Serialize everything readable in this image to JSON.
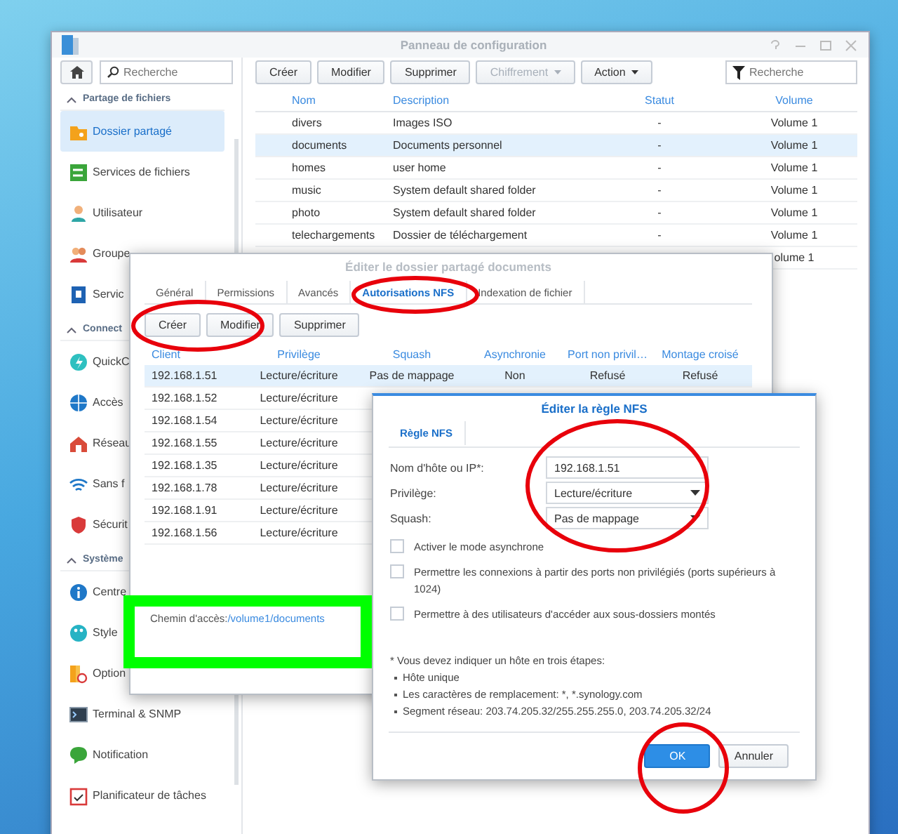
{
  "window": {
    "title": "Panneau de configuration"
  },
  "sidebar": {
    "search": {
      "placeholder": "Recherche"
    },
    "sections": [
      {
        "title": "Partage de fichiers",
        "expanded": true,
        "items": [
          {
            "label": "Dossier partagé",
            "selected": true
          },
          {
            "label": "Services de fichiers",
            "selected": false
          },
          {
            "label": "Utilisateur",
            "selected": false
          },
          {
            "label": "Groupe",
            "selected": false
          },
          {
            "label": "Servic",
            "selected": false
          }
        ]
      },
      {
        "title": "Connect",
        "expanded": true,
        "items": [
          {
            "label": "QuickC",
            "selected": false
          },
          {
            "label": "Accès",
            "selected": false
          },
          {
            "label": "Réseau",
            "selected": false
          },
          {
            "label": "Sans f",
            "selected": false
          },
          {
            "label": "Sécurit",
            "selected": false
          }
        ]
      },
      {
        "title": "Système",
        "expanded": true,
        "items": [
          {
            "label": "Centre",
            "selected": false
          },
          {
            "label": "Style",
            "selected": false
          },
          {
            "label": "Option",
            "selected": false
          },
          {
            "label": "Terminal & SNMP",
            "selected": false
          },
          {
            "label": "Notification",
            "selected": false
          },
          {
            "label": "Planificateur de tâches",
            "selected": false
          }
        ]
      }
    ]
  },
  "toolbar": {
    "buttons": [
      {
        "label": "Créer",
        "disabled": false,
        "dropdown": false
      },
      {
        "label": "Modifier",
        "disabled": false,
        "dropdown": false
      },
      {
        "label": "Supprimer",
        "disabled": false,
        "dropdown": false
      },
      {
        "label": "Chiffrement",
        "disabled": true,
        "dropdown": true
      },
      {
        "label": "Action",
        "disabled": false,
        "dropdown": true
      }
    ],
    "filter": {
      "placeholder": "Recherche"
    }
  },
  "table": {
    "columns": [
      "Nom",
      "Description",
      "Statut",
      "Volume"
    ],
    "rows": [
      {
        "name": "divers",
        "description": "Images ISO",
        "status": "-",
        "volume": "Volume 1",
        "selected": false
      },
      {
        "name": "documents",
        "description": "Documents personnel",
        "status": "-",
        "volume": "Volume 1",
        "selected": true
      },
      {
        "name": "homes",
        "description": "user home",
        "status": "-",
        "volume": "Volume 1",
        "selected": false
      },
      {
        "name": "music",
        "description": "System default shared folder",
        "status": "-",
        "volume": "Volume 1",
        "selected": false
      },
      {
        "name": "photo",
        "description": "System default shared folder",
        "status": "-",
        "volume": "Volume 1",
        "selected": false
      },
      {
        "name": "telechargements",
        "description": "Dossier de téléchargement",
        "status": "-",
        "volume": "Volume 1",
        "selected": false
      },
      {
        "volume": "olume 1",
        "selected": false
      }
    ]
  },
  "share_dialog": {
    "title": "Éditer le dossier partagé documents",
    "tabs": [
      {
        "label": "Général",
        "selected": false
      },
      {
        "label": "Permissions",
        "selected": false
      },
      {
        "label": "Avancés",
        "selected": false
      },
      {
        "label": "Autorisations NFS",
        "selected": true
      },
      {
        "label": "Indexation de fichier",
        "selected": false
      }
    ],
    "buttons": [
      "Créer",
      "Modifier",
      "Supprimer"
    ],
    "table": {
      "columns": [
        "Client",
        "Privilège",
        "Squash",
        "Asynchronie",
        "Port non privil…",
        "Montage croisé"
      ],
      "rows": [
        {
          "client": "192.168.1.51",
          "privilege": "Lecture/écriture",
          "squash": "Pas de mappage",
          "async": "Non",
          "port": "Refusé",
          "cross_mount": "Refusé",
          "selected": true
        },
        {
          "client": "192.168.1.52",
          "privilege": "Lecture/écriture",
          "selected": false
        },
        {
          "client": "192.168.1.54",
          "privilege": "Lecture/écriture",
          "selected": false
        },
        {
          "client": "192.168.1.55",
          "privilege": "Lecture/écriture",
          "selected": false
        },
        {
          "client": "192.168.1.35",
          "privilege": "Lecture/écriture",
          "selected": false
        },
        {
          "client": "192.168.1.78",
          "privilege": "Lecture/écriture",
          "selected": false
        },
        {
          "client": "192.168.1.91",
          "privilege": "Lecture/écriture",
          "selected": false
        },
        {
          "client": "192.168.1.56",
          "privilege": "Lecture/écriture",
          "selected": false
        }
      ]
    },
    "path": {
      "label": "Chemin d'accès:",
      "value": "/volume1/documents"
    }
  },
  "rule_dialog": {
    "title": "Éditer la règle NFS",
    "tabs": [
      {
        "label": "Règle NFS",
        "selected": true
      }
    ],
    "fields": [
      {
        "kind": "text",
        "label": "Nom d'hôte ou IP*:",
        "value": "192.168.1.51"
      },
      {
        "kind": "select",
        "label": "Privilège:",
        "value": "Lecture/écriture"
      },
      {
        "kind": "select",
        "label": "Squash:",
        "value": "Pas de mappage"
      }
    ],
    "options": [
      {
        "label": "Activer le mode asynchrone",
        "checked": false
      },
      {
        "label": "Permettre les connexions à partir des ports non privilégiés (ports supérieurs à 1024)",
        "checked": false
      },
      {
        "label": "Permettre à des utilisateurs d'accéder aux sous-dossiers montés",
        "checked": false
      }
    ],
    "note": {
      "heading": "* Vous devez indiquer un hôte en trois étapes:",
      "bullets": [
        "Hôte unique",
        "Les caractères de remplacement: *, *.synology.com",
        "Segment réseau: 203.74.205.32/255.255.255.0, 203.74.205.32/24"
      ]
    },
    "buttons": [
      {
        "label": "OK",
        "primary": true
      },
      {
        "label": "Annuler",
        "primary": false
      }
    ]
  }
}
